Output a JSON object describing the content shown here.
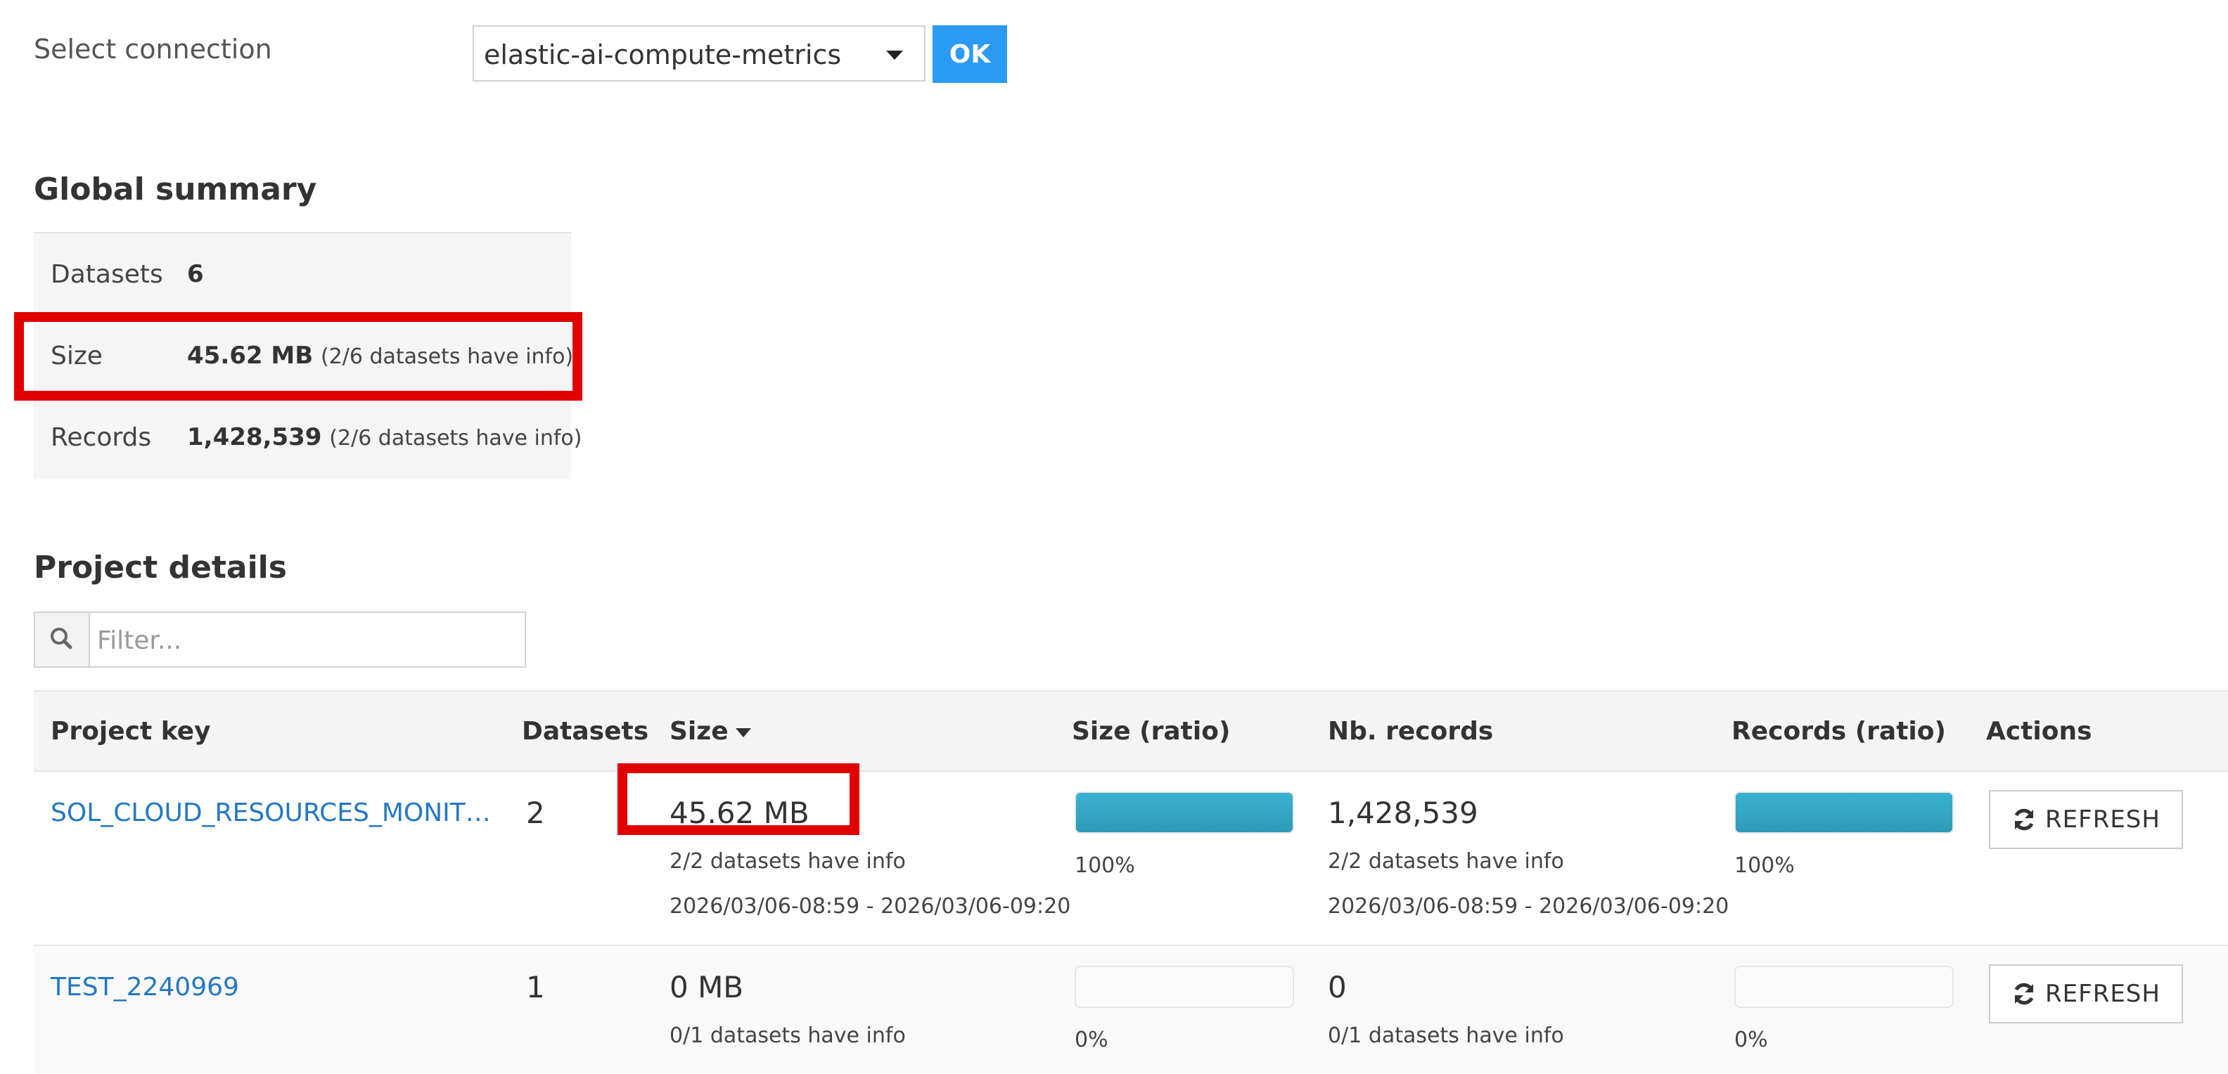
{
  "connection": {
    "label": "Select connection",
    "selected": "elastic-ai-compute-metrics",
    "ok_label": "OK"
  },
  "global_summary": {
    "title": "Global summary",
    "rows": [
      {
        "key": "Datasets",
        "value": "6",
        "note": ""
      },
      {
        "key": "Size",
        "value": "45.62 MB",
        "note": "(2/6 datasets have info)"
      },
      {
        "key": "Records",
        "value": "1,428,539",
        "note": "(2/6 datasets have info)"
      }
    ]
  },
  "project_details": {
    "title": "Project details",
    "filter_placeholder": "Filter...",
    "columns": [
      "Project key",
      "Datasets",
      "Size",
      "Size (ratio)",
      "Nb. records",
      "Records (ratio)",
      "Actions"
    ],
    "rows": [
      {
        "project_key": "SOL_CLOUD_RESOURCES_MONIT…",
        "datasets": "2",
        "size": "45.62 MB",
        "size_info": "2/2 datasets have info",
        "size_range": "2026/03/06-08:59 - 2026/03/06-09:20",
        "size_ratio": 100,
        "size_ratio_label": "100%",
        "records": "1,428,539",
        "records_info": "2/2 datasets have info",
        "records_range": "2026/03/06-08:59 - 2026/03/06-09:20",
        "records_ratio": 100,
        "records_ratio_label": "100%",
        "action_label": "REFRESH"
      },
      {
        "project_key": "TEST_2240969",
        "datasets": "1",
        "size": "0 MB",
        "size_info": "0/1 datasets have info",
        "size_range": "",
        "size_ratio": 0,
        "size_ratio_label": "0%",
        "records": "0",
        "records_info": "0/1 datasets have info",
        "records_range": "",
        "records_ratio": 0,
        "records_ratio_label": "0%",
        "action_label": "REFRESH"
      }
    ]
  },
  "colors": {
    "accent": "#2b9af3",
    "link": "#2478c4",
    "bar_fill": "#3ab2cf",
    "highlight": "#e00000"
  }
}
